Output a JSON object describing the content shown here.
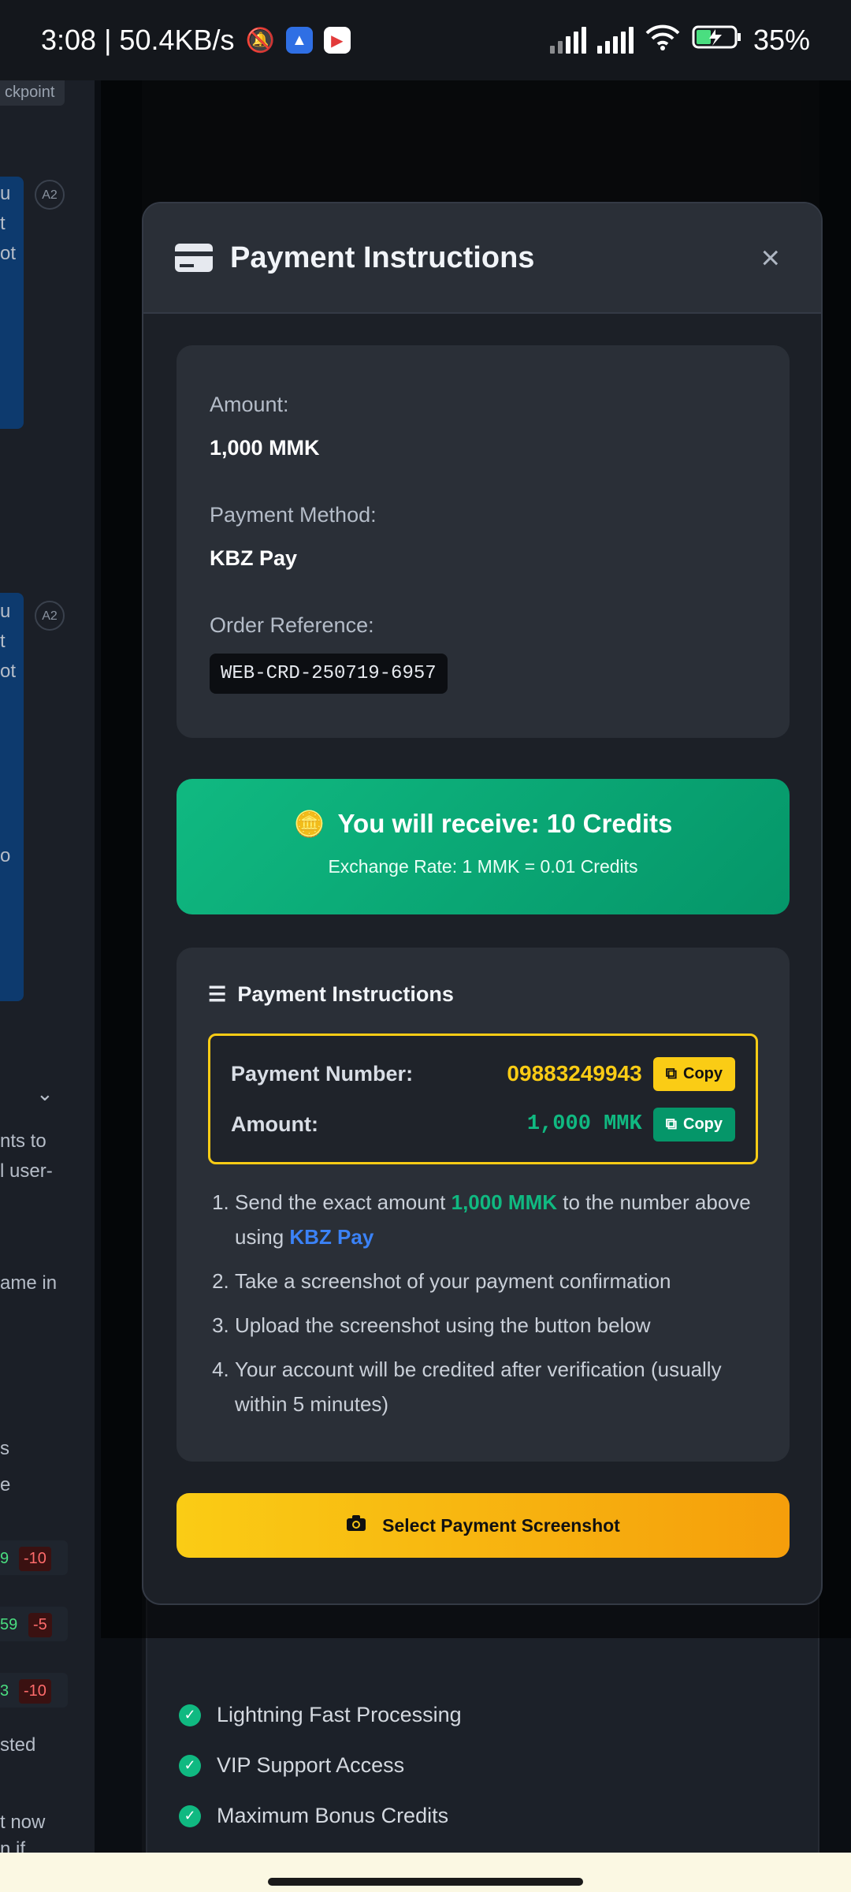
{
  "status_bar": {
    "time_speed": "3:08 | 50.4KB/s",
    "battery": "35%"
  },
  "background": {
    "chip": "ckpoint",
    "avatar_badge": "A2",
    "snippets": [
      "u",
      "t",
      "ot",
      "o",
      "nts to",
      "l user-",
      "ame in",
      "s",
      "e",
      "sted",
      "t now",
      "n if"
    ],
    "pos_values": [
      "9",
      "59",
      "3"
    ],
    "neg_values": [
      "-10",
      "-5",
      "-10"
    ],
    "features": [
      "Lightning Fast Processing",
      "VIP Support Access",
      "Maximum Bonus Credits"
    ]
  },
  "modal": {
    "title": "Payment Instructions",
    "close": "×",
    "amount_label": "Amount:",
    "amount_value": "1,000 MMK",
    "method_label": "Payment Method:",
    "method_value": "KBZ Pay",
    "ref_label": "Order Reference:",
    "ref_value": "WEB-CRD-250719-6957",
    "receive_title": "You will receive: 10 Credits",
    "receive_rate": "Exchange Rate: 1 MMK = 0.01 Credits",
    "instr_title": "Payment Instructions",
    "pay_number_label": "Payment Number:",
    "pay_number_value": "09883249943",
    "pay_amount_label": "Amount:",
    "pay_amount_value": "1,000 MMK",
    "copy_label": "Copy",
    "steps": {
      "s1_pre": "Send the exact amount ",
      "s1_amount": "1,000 MMK",
      "s1_mid": " to the number above using ",
      "s1_method": "KBZ Pay",
      "s2": "Take a screenshot of your payment confirmation",
      "s3": "Upload the screenshot using the button below",
      "s4": "Your account will be credited after verification (usually within 5 minutes)"
    },
    "select_button": "Select Payment Screenshot"
  }
}
